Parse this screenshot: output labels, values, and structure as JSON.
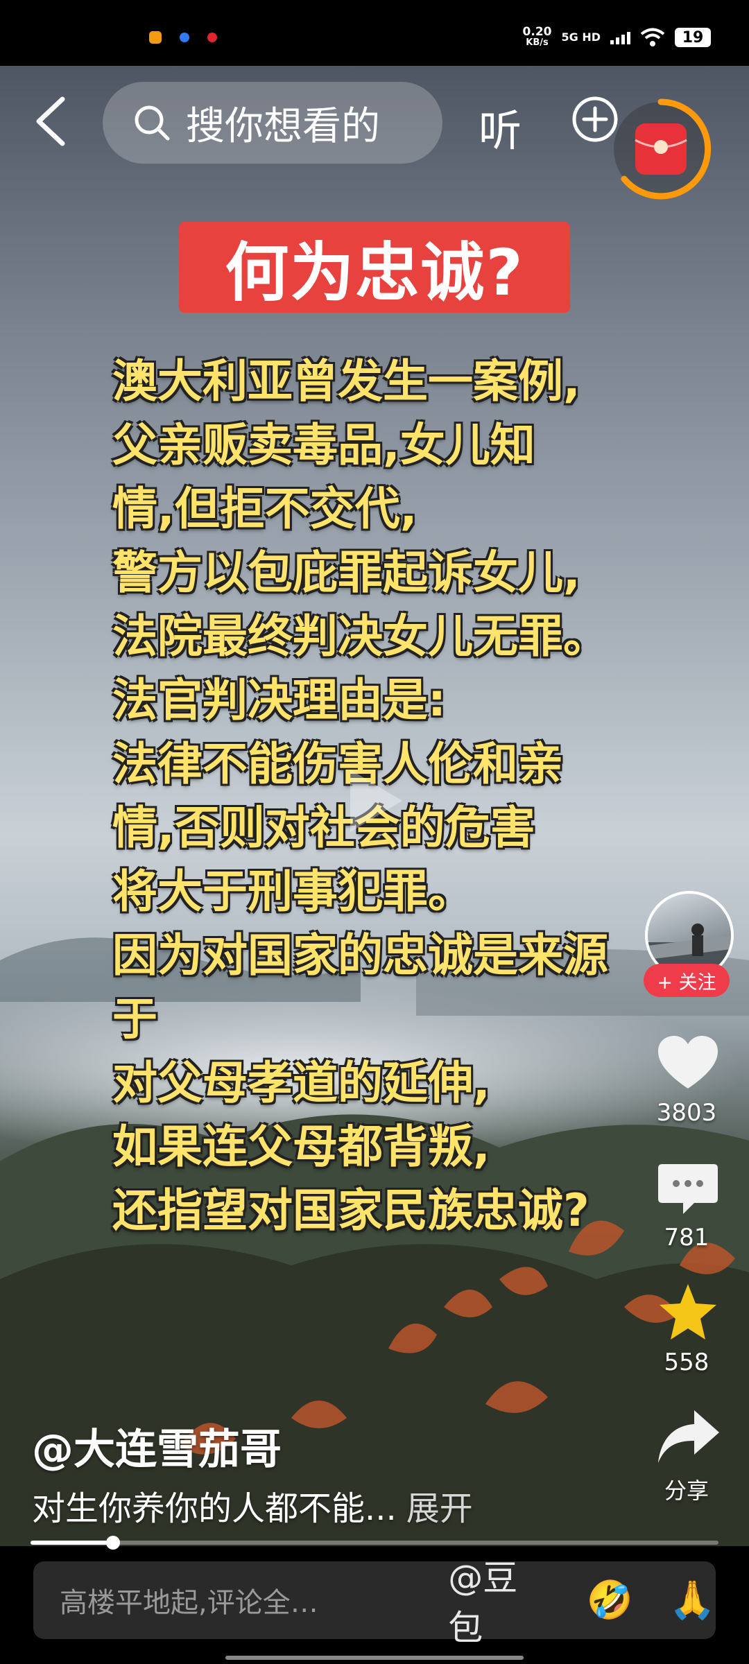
{
  "status_bar": {
    "speed_value": "0.20",
    "speed_unit": "KB/s",
    "network": "5G HD",
    "battery": "19",
    "app_icon_colors": [
      "#f39c12",
      "#2f7cf6",
      "#e0262c"
    ]
  },
  "top_bar": {
    "search_placeholder": "搜你想看的",
    "listen_label": "听"
  },
  "video": {
    "title": "何为忠诚?",
    "lines": [
      "澳大利亚曾发生一案例,",
      "父亲贩卖毒品,女儿知",
      "情,但拒不交代,",
      "警方以包庇罪起诉女儿,",
      "法院最终判决女儿无罪。",
      "法官判决理由是:",
      "法律不能伤害人伦和亲",
      "情,否则对社会的危害",
      "将大于刑事犯罪。",
      "因为对国家的忠诚是来源",
      "于",
      "对父母孝道的延伸,",
      "如果连父母都背叛,",
      "还指望对国家民族忠诚?"
    ]
  },
  "right_rail": {
    "follow_label": "+ 关注",
    "likes": "3803",
    "comments": "781",
    "favorites": "558",
    "share_label": "分享"
  },
  "caption": {
    "author": "@大连雪茄哥",
    "description": "对生你养你的人都不能...",
    "expand_label": "展开"
  },
  "playback": {
    "progress": 0.12
  },
  "comment_bar": {
    "placeholder": "高楼平地起,评论全…",
    "mention": "@豆包",
    "emoji_1": "🤣",
    "emoji_2": "🙏"
  },
  "colors": {
    "title_bg": "#e8423f",
    "text_yellow": "#ffe36a",
    "follow_red": "#ee3c4b",
    "star_yellow": "#f5c518"
  }
}
